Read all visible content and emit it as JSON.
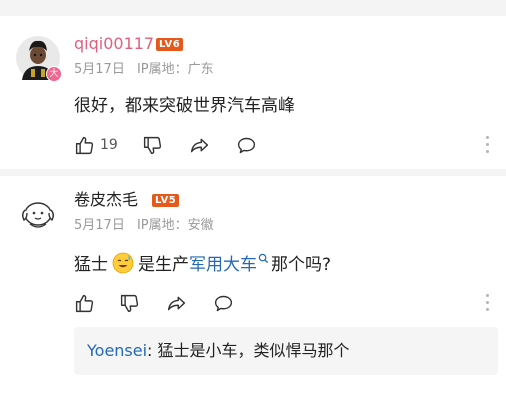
{
  "comments": [
    {
      "username": "qiqi00117",
      "level": "LV6",
      "date": "5月17日",
      "ip_location": "IP属地：广东",
      "text": "很好，都来突破世界汽车高峰",
      "like_count": "19",
      "avatar_badge": "大"
    },
    {
      "username": "卷皮杰毛",
      "level": "LV5",
      "date": "5月17日",
      "ip_location": "IP属地：安徽",
      "text_before": "猛士",
      "text_middle": "是生产",
      "link_text": "军用大车",
      "text_after": "那个吗?",
      "emoji": "smile-sweat-emoji",
      "reply": {
        "author": "Yoensei",
        "separator": ": ",
        "text": "猛士是小车，类似悍马那个"
      }
    }
  ],
  "icons": {
    "like": "thumbs-up-icon",
    "dislike": "thumbs-down-icon",
    "share": "share-icon",
    "comment": "comment-icon",
    "more": "more-vertical-icon",
    "link_search": "search-icon"
  },
  "colors": {
    "username_highlight": "#e0607e",
    "level_badge": "#e55a1c",
    "link": "#2469b8",
    "meta": "#9a9a9a"
  }
}
